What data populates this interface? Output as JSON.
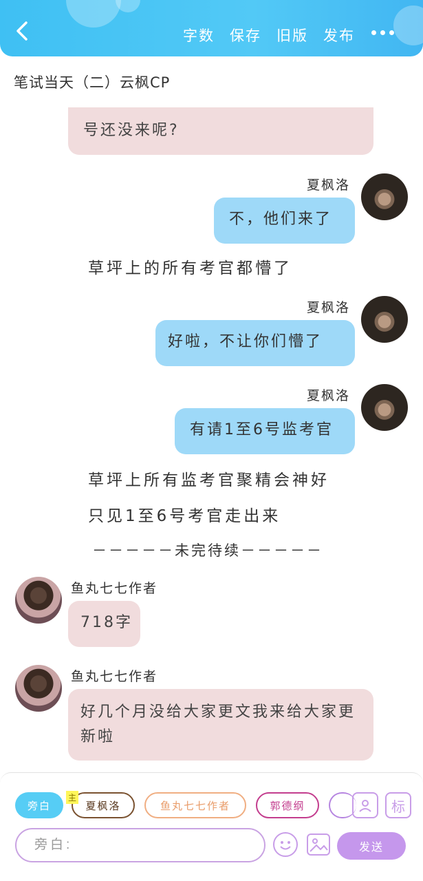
{
  "header": {
    "actions": {
      "word_count": "字数",
      "save": "保存",
      "old_version": "旧版",
      "publish": "发布"
    }
  },
  "chapter": {
    "title": "笔试当天（二）云枫CP"
  },
  "messages": {
    "top_partial": {
      "text": "号还没来呢?"
    },
    "m1": {
      "speaker": "夏枫洛",
      "text": "不，他们来了"
    },
    "n1": {
      "text": "草坪上的所有考官都懵了"
    },
    "m2": {
      "speaker": "夏枫洛",
      "text": "好啦，不让你们懵了"
    },
    "m3": {
      "speaker": "夏枫洛",
      "text": "有请1至6号监考官"
    },
    "n2": {
      "text": "草坪上所有监考官聚精会神好"
    },
    "n3": {
      "text": "只见1至6号考官走出来"
    },
    "tbc": {
      "text": "－－－－－未完待续－－－－－"
    },
    "a1": {
      "speaker": "鱼丸七七作者",
      "text": "718字"
    },
    "a2": {
      "speaker": "鱼丸七七作者",
      "text": "好几个月没给大家更文我来给大家更新啦"
    }
  },
  "composer": {
    "roles": [
      "旁白",
      "夏枫洛",
      "鱼丸七七作者",
      "郭德纲"
    ],
    "role_tag": "主",
    "placeholder": "旁白:",
    "side_label": "标",
    "send_label": "发送"
  }
}
